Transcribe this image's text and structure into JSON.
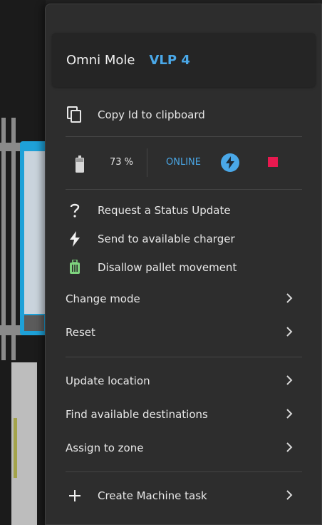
{
  "header": {
    "name": "Omni Mole",
    "vehicle": "VLP 4"
  },
  "copy_id": {
    "label": "Copy Id to clipboard",
    "icon": "copy-icon"
  },
  "status": {
    "battery_percent": "73 %",
    "connection": "ONLINE",
    "battery_icon": "battery-icon",
    "charging_icon": "bolt-icon",
    "stop_icon": "stop-icon",
    "colors": {
      "online": "#4aa8e8",
      "stop": "#e8194f",
      "pallet_icon": "#7ed37e"
    }
  },
  "actions": [
    {
      "label": "Request a Status Update",
      "icon": "question-icon"
    },
    {
      "label": "Send to available charger",
      "icon": "bolt-icon"
    },
    {
      "label": "Disallow pallet movement",
      "icon": "pallet-icon"
    }
  ],
  "submenus_a": [
    {
      "label": "Change mode"
    },
    {
      "label": "Reset"
    }
  ],
  "submenus_b": [
    {
      "label": "Update location"
    },
    {
      "label": "Find available destinations"
    },
    {
      "label": "Assign to zone"
    }
  ],
  "create_task": {
    "label": "Create Machine task",
    "icon": "plus-icon"
  }
}
